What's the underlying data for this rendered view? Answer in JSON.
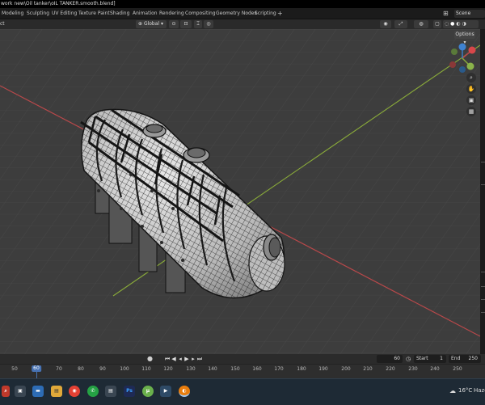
{
  "titlebar": {
    "text": "work new\\Oil tanker\\oIL TANKER.smooth.blend]"
  },
  "workspaces": [
    {
      "label": "Modeling"
    },
    {
      "label": "Sculpting"
    },
    {
      "label": "UV Editing"
    },
    {
      "label": "Texture Paint"
    },
    {
      "label": "Shading"
    },
    {
      "label": "Animation"
    },
    {
      "label": "Rendering"
    },
    {
      "label": "Compositing"
    },
    {
      "label": "Geometry Nodes"
    },
    {
      "label": "Scripting"
    }
  ],
  "add_workspace": "+",
  "scene": {
    "label": "Scene"
  },
  "header": {
    "left_label": "ct",
    "orientation": "Global",
    "options": "Options"
  },
  "timeline": {
    "current_frame": "60",
    "start_label": "Start",
    "start_value": "1",
    "end_label": "End",
    "end_value": "250",
    "ticks": [
      "50",
      "60",
      "70",
      "80",
      "90",
      "100",
      "110",
      "120",
      "130",
      "140",
      "150",
      "160",
      "170",
      "180",
      "190",
      "200",
      "210",
      "220",
      "230",
      "240",
      "250"
    ],
    "playhead": "60"
  },
  "taskbar": {
    "weather_temp": "16°C",
    "weather_text": "Haze",
    "apps": [
      {
        "name": "search",
        "glyph": "⌕"
      },
      {
        "name": "task-view",
        "glyph": "▣"
      },
      {
        "name": "file-explorer",
        "glyph": "▬"
      },
      {
        "name": "chrome",
        "glyph": "◉"
      },
      {
        "name": "whatsapp",
        "glyph": "✆"
      },
      {
        "name": "store",
        "glyph": "▤"
      },
      {
        "name": "photoshop",
        "glyph": "Ps"
      },
      {
        "name": "torrent",
        "glyph": "µ"
      },
      {
        "name": "media",
        "glyph": "▶"
      },
      {
        "name": "blender",
        "glyph": "◐"
      }
    ]
  },
  "colors": {
    "viewport_bg": "#3d3d3d",
    "x_axis": "#b8484a",
    "y_axis": "#8aab3a",
    "accent": "#4772b3",
    "taskbar": "#1e2a35"
  }
}
